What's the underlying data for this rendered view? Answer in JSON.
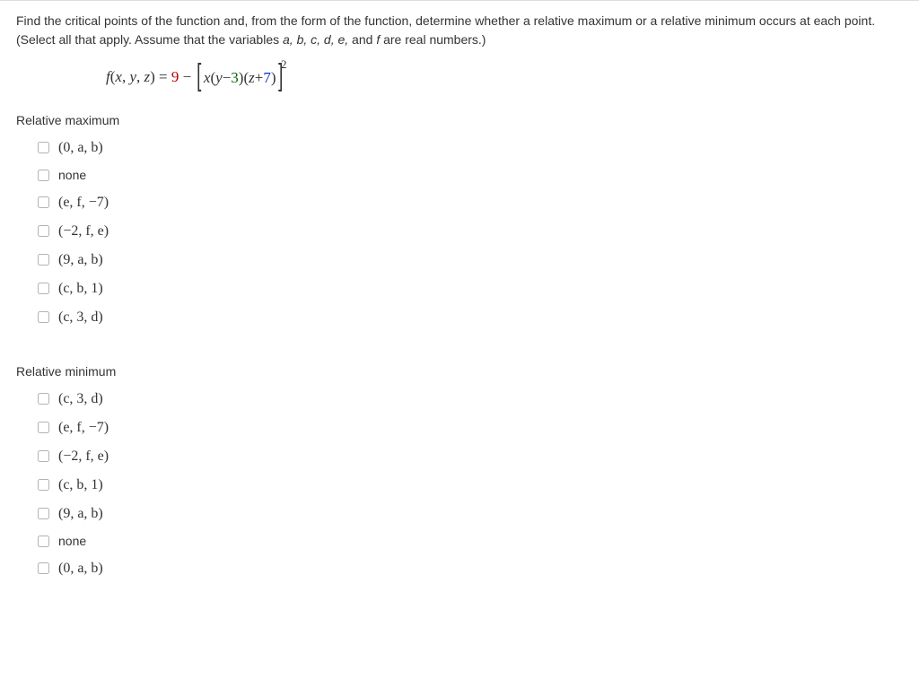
{
  "question": {
    "line1_pre": "Find the critical points of the function and, from the form of the function, determine whether a relative maximum or a relative minimum occurs at each point. (Select all that apply. Assume that the variables ",
    "vars": "a, b, c, d, e,",
    "and": " and ",
    "lastvar": "f",
    "line1_post": " are real numbers.)"
  },
  "formula": {
    "f": "f",
    "args_open": "(",
    "x": "x",
    "c1": ", ",
    "y": "y",
    "c2": ", ",
    "z": "z",
    "args_close": ") = ",
    "nine": "9",
    "minus": " − ",
    "x2": "x",
    "open_y": "(",
    "y2": "y",
    "minus2": " − ",
    "three": "3",
    "close_y": ")(",
    "z2": "z",
    "plus": " + ",
    "seven": "7",
    "close_z": ")"
  },
  "sections": {
    "max_title": "Relative maximum",
    "min_title": "Relative minimum"
  },
  "max_options": [
    "(0, a, b)",
    "none",
    "(e, f, −7)",
    "(−2, f, e)",
    "(9, a, b)",
    "(c, b, 1)",
    "(c, 3, d)"
  ],
  "min_options": [
    "(c, 3, d)",
    "(e, f, −7)",
    "(−2, f, e)",
    "(c, b, 1)",
    "(9, a, b)",
    "none",
    "(0, a, b)"
  ]
}
